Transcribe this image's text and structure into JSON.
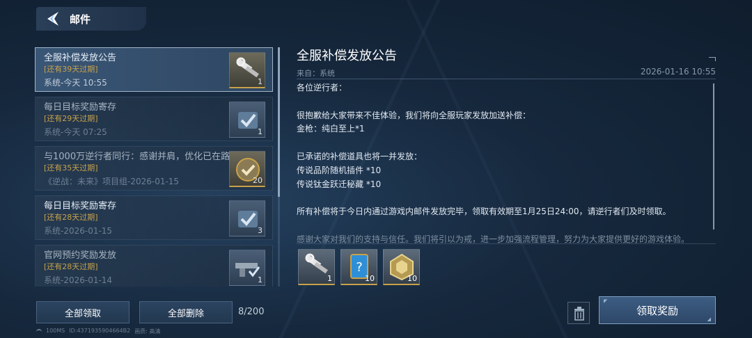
{
  "header": {
    "title": "邮件"
  },
  "mails": [
    {
      "title": "全服补偿发放公告",
      "expire": "[还有39天过期]",
      "sender": "系统-今天 10:55",
      "count": "1",
      "icon": "wrench-weapon-icon",
      "selected": true,
      "read": false
    },
    {
      "title": "每日目标奖励寄存",
      "expire": "[还有29天过期]",
      "sender": "系统-今天 07:25",
      "count": "1",
      "icon": "checkmark-crate-icon",
      "selected": false,
      "read": true
    },
    {
      "title": "与1000万逆行者同行：感谢并肩，优化已在路上",
      "expire": "[还有35天过期]",
      "sender": "《逆战：未来》项目组-2026-01-15",
      "count": "20",
      "icon": "check-medal-icon",
      "selected": false,
      "read": true
    },
    {
      "title": "每日目标奖励寄存",
      "expire": "[还有28天过期]",
      "sender": "系统-2026-01-15",
      "count": "3",
      "icon": "checkmark-crate-icon",
      "selected": false,
      "read": false
    },
    {
      "title": "官网预约奖励发放",
      "expire": "[还有28天过期]",
      "sender": "系统-2026-01-14",
      "count": "1",
      "icon": "gun-icon",
      "selected": false,
      "read": true
    }
  ],
  "detail": {
    "title": "全服补偿发放公告",
    "sender": "来自：系统",
    "time": "2026-01-16 10:55",
    "body": [
      "各位逆行者：",
      "",
      "很抱歉给大家带来不佳体验，我们将向全服玩家发放加送补偿：",
      "金枪：纯白至上*1",
      "",
      "已承诺的补偿道具也将一并发放：",
      "传说品阶随机插件 *10",
      "传说钛金跃迁秘藏 *10",
      "",
      "所有补偿将于今日内通过游戏内邮件发放完毕，领取有效期至1月25日24:00，请逆行者们及时领取。",
      "",
      "感谢大家对我们的支持与信任。我们将引以为戒，进一步加强流程管理，努力为大家提供更好的游戏体验。"
    ],
    "attachments": [
      {
        "icon": "wrench-weapon-icon",
        "count": "1"
      },
      {
        "icon": "mystery-card-icon",
        "count": "10"
      },
      {
        "icon": "gold-chest-icon",
        "count": "10"
      }
    ]
  },
  "footer": {
    "claim_all": "全部领取",
    "delete_all": "全部删除",
    "mail_count": "8/200",
    "claim_reward": "领取奖励",
    "status": {
      "ping": "100MS",
      "id": "ID:4371935904664B2",
      "quality": "画质: 高清"
    }
  },
  "colors": {
    "expire": "#c9a24a",
    "accent": "#7ea0c4"
  }
}
